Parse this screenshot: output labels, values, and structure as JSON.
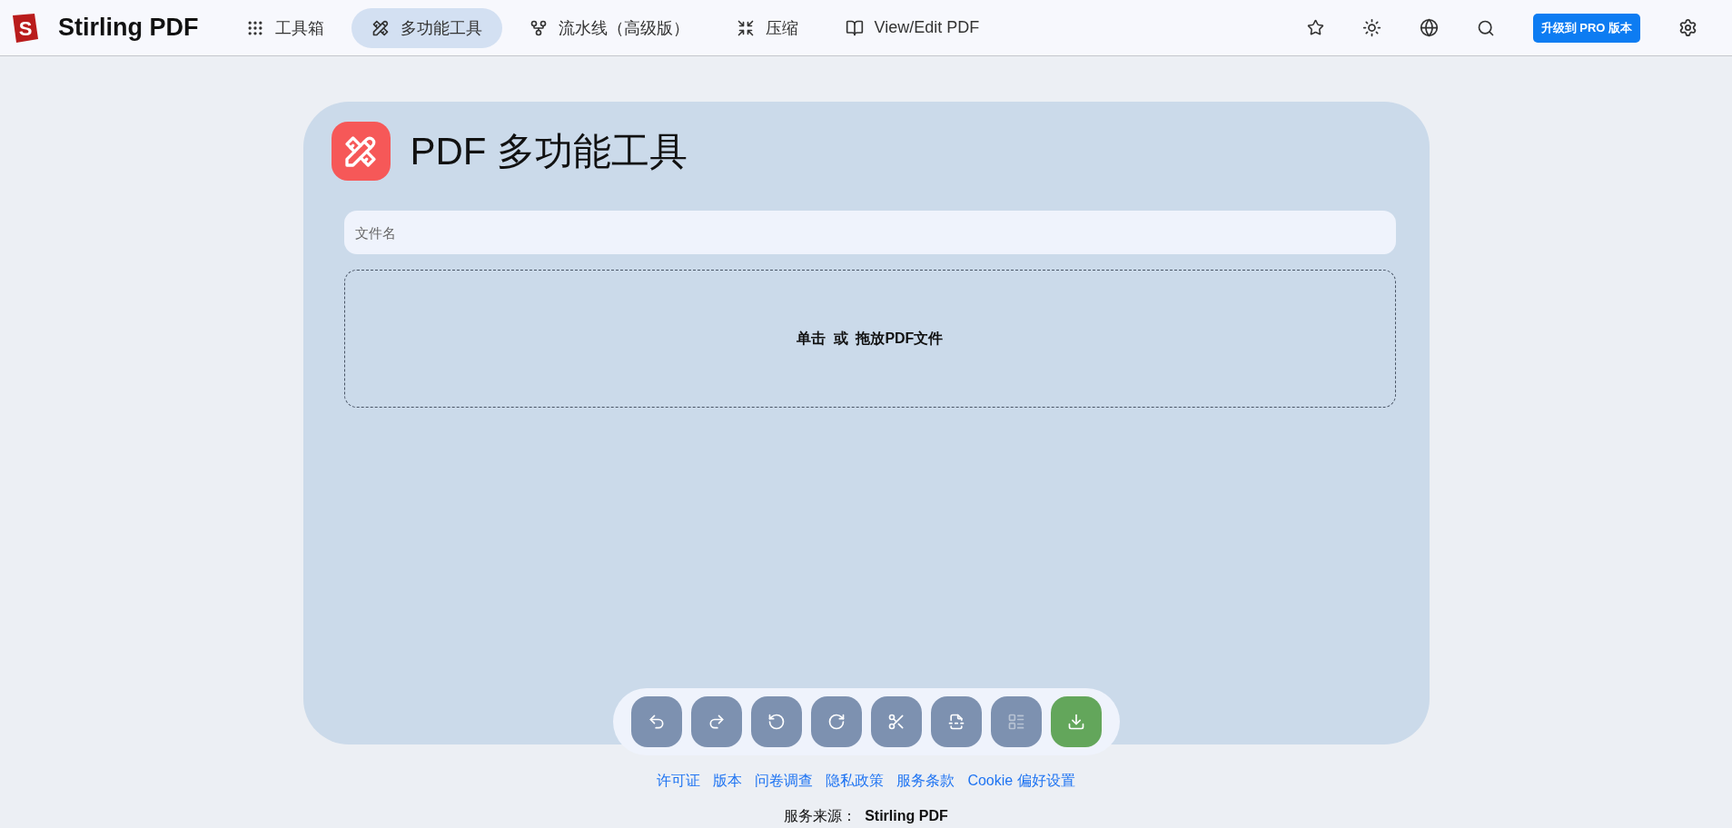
{
  "brand": {
    "logo_letter": "S",
    "name": "Stirling PDF"
  },
  "nav": [
    {
      "label": "工具箱",
      "selected": false
    },
    {
      "label": "多功能工具",
      "selected": true
    },
    {
      "label": "流水线（高级版）",
      "selected": false
    },
    {
      "label": "压缩",
      "selected": false
    },
    {
      "label": "View/Edit PDF",
      "selected": false
    }
  ],
  "upgrade_button": "升级到 PRO 版本",
  "card": {
    "title": "PDF 多功能工具",
    "filename": {
      "placeholder": "文件名"
    },
    "dropzone": "单击  或  拖放PDF文件"
  },
  "toolbar": [
    {
      "kind": "action",
      "disabled": false
    },
    {
      "kind": "action",
      "disabled": false
    },
    {
      "kind": "action",
      "disabled": false
    },
    {
      "kind": "action",
      "disabled": false
    },
    {
      "kind": "action",
      "disabled": false
    },
    {
      "kind": "action",
      "disabled": false
    },
    {
      "kind": "action",
      "disabled": true
    },
    {
      "kind": "download",
      "disabled": false
    }
  ],
  "footer": {
    "links": [
      "许可证",
      "版本",
      "问卷调查",
      "隐私政策",
      "服务条款",
      "Cookie 偏好设置"
    ],
    "powered_by": "服务来源：  **Stirling PDF**"
  }
}
